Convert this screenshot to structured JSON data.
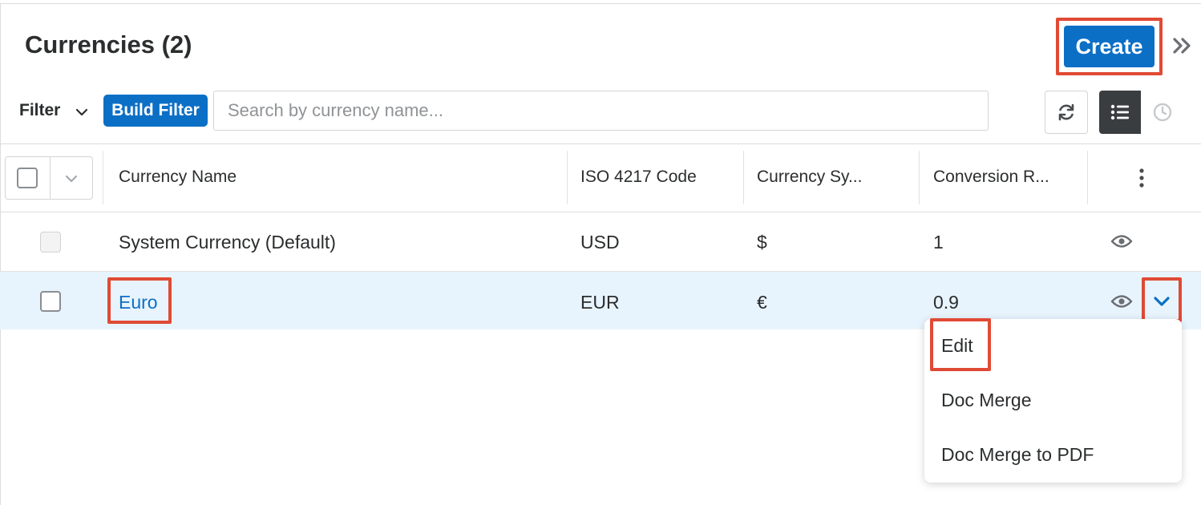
{
  "header": {
    "title": "Currencies (2)",
    "create_label": "Create"
  },
  "toolbar": {
    "filter_label": "Filter",
    "build_filter_label": "Build Filter",
    "search_placeholder": "Search by currency name..."
  },
  "table": {
    "columns": [
      "Currency Name",
      "ISO 4217 Code",
      "Currency Sy...",
      "Conversion R..."
    ],
    "rows": [
      {
        "name": "System Currency (Default)",
        "iso": "USD",
        "symbol": "$",
        "rate": "1"
      },
      {
        "name": "Euro",
        "iso": "EUR",
        "symbol": "€",
        "rate": "0.9"
      }
    ]
  },
  "row_menu": {
    "items": [
      "Edit",
      "Doc Merge",
      "Doc Merge to PDF"
    ]
  },
  "colors": {
    "primary": "#0b6fc6",
    "highlight": "#e04a35",
    "selected_row": "#e8f4fd"
  }
}
